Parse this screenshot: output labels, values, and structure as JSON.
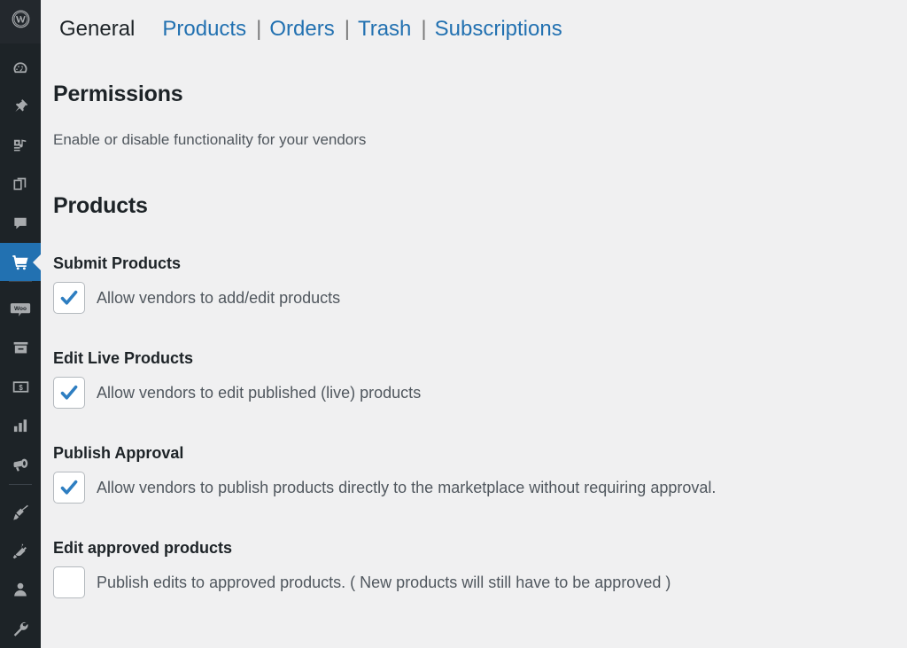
{
  "sidebar": {
    "logo": {
      "icon": "wordpress-logo-icon",
      "label": "WordPress"
    },
    "items": [
      {
        "icon": "dashboard-gauge-icon",
        "label": "Dashboard",
        "active": false
      },
      {
        "icon": "pin-posts-icon",
        "label": "Posts",
        "active": false
      },
      {
        "icon": "media-icon",
        "label": "Media",
        "active": false
      },
      {
        "icon": "pages-icon",
        "label": "Pages",
        "active": false
      },
      {
        "icon": "comments-icon",
        "label": "Comments",
        "active": false
      },
      {
        "icon": "cart-icon",
        "label": "Products",
        "active": true
      },
      {
        "icon": "woocommerce-icon",
        "label": "WooCommerce",
        "active": false
      },
      {
        "icon": "archive-box-icon",
        "label": "Products",
        "active": false
      },
      {
        "icon": "payments-dollar-icon",
        "label": "Payments",
        "active": false
      },
      {
        "icon": "analytics-bars-icon",
        "label": "Analytics",
        "active": false
      },
      {
        "icon": "megaphone-icon",
        "label": "Marketing",
        "active": false
      },
      {
        "icon": "paintbrush-icon",
        "label": "Appearance",
        "active": false
      },
      {
        "icon": "plugin-icon",
        "label": "Plugins",
        "active": false
      },
      {
        "icon": "user-icon",
        "label": "Users",
        "active": false
      },
      {
        "icon": "wrench-icon",
        "label": "Tools",
        "active": false
      }
    ]
  },
  "tabs": [
    {
      "label": "General",
      "current": true
    },
    {
      "label": "Products",
      "current": false
    },
    {
      "label": "Orders",
      "current": false
    },
    {
      "label": "Trash",
      "current": false
    },
    {
      "label": "Subscriptions",
      "current": false
    }
  ],
  "tab_separator": "|",
  "page": {
    "heading": "Permissions",
    "subtitle": "Enable or disable functionality for your vendors",
    "group_heading": "Products"
  },
  "fields": [
    {
      "label": "Submit Products",
      "checkbox_label": "Allow vendors to add/edit products",
      "checked": true
    },
    {
      "label": "Edit Live Products",
      "checkbox_label": "Allow vendors to edit published (live) products",
      "checked": true
    },
    {
      "label": "Publish Approval",
      "checkbox_label": "Allow vendors to publish products directly to the marketplace without requiring approval.",
      "checked": true
    },
    {
      "label": "Edit approved products",
      "checkbox_label": "Publish edits to approved products. ( New products will still have to be approved )",
      "checked": false
    }
  ],
  "colors": {
    "admin_blue": "#2271b1",
    "sidebar_bg": "#1d2327",
    "content_bg": "#f0f0f1",
    "annotation_red": "#ff0000",
    "heading": "#1d2327",
    "body_text": "#50575e"
  }
}
